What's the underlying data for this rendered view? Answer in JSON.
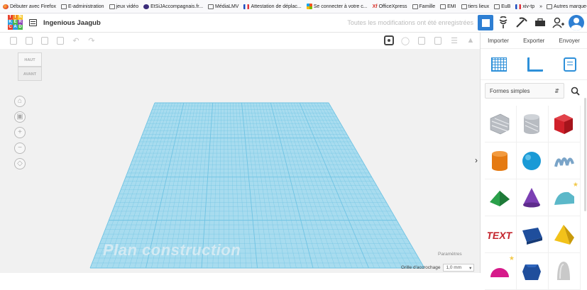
{
  "bookmarks": [
    {
      "icon": "firefox-icon",
      "label": "Débuter avec Firefox"
    },
    {
      "icon": "folder-icon",
      "label": "E-administration"
    },
    {
      "icon": "folder-icon",
      "label": "jeux vidéo"
    },
    {
      "icon": "globe-icon",
      "label": "EtSiJAccompagnais.fr..."
    },
    {
      "icon": "folder-icon",
      "label": "MédiaLMV"
    },
    {
      "icon": "flag-icon",
      "label": "Attestation de déplac..."
    },
    {
      "icon": "windows-icon",
      "label": "Se connecter à votre c..."
    },
    {
      "icon": "office-icon",
      "label": "OfficeXpress"
    },
    {
      "icon": "folder-icon",
      "label": "Famille"
    },
    {
      "icon": "folder-icon",
      "label": "EMI"
    },
    {
      "icon": "folder-icon",
      "label": "tiers lieux"
    },
    {
      "icon": "folder-icon",
      "label": "EuB"
    },
    {
      "icon": "flag-icon",
      "label": "xiv-tp"
    }
  ],
  "bookmarks_overflow": "»",
  "bookmarks_other": "Autres marque-pages",
  "header": {
    "logo_letters": [
      "TIN",
      "KER",
      "CAD"
    ],
    "project_title": "Ingenious Jaagub",
    "save_status": "Toutes les modifications ont été enregistrées"
  },
  "workplane": {
    "label": "Plan construction",
    "view_cube_top": "HAUT",
    "view_cube_front": "AVANT"
  },
  "footer": {
    "params_label": "Paramètres",
    "snap_label": "Grille d'accrochage",
    "snap_value": "1,0 mm"
  },
  "panel": {
    "tabs": [
      "Importer",
      "Exporter",
      "Envoyer"
    ],
    "category": "Formes simples",
    "shapes": [
      {
        "name": "box-hole-shape",
        "color": "#b8bcc2"
      },
      {
        "name": "cylinder-hole-shape",
        "color": "#b8bcc2"
      },
      {
        "name": "box-shape",
        "color": "#d0202a"
      },
      {
        "name": "cylinder-shape",
        "color": "#e57a12"
      },
      {
        "name": "sphere-shape",
        "color": "#1a9ad6"
      },
      {
        "name": "scribble-shape",
        "color": "#7aa4c8"
      },
      {
        "name": "roof-shape",
        "color": "#2aa04a"
      },
      {
        "name": "cone-shape",
        "color": "#7b3fb3"
      },
      {
        "name": "round-roof-shape",
        "color": "#5bb8c9"
      },
      {
        "name": "text-shape",
        "color": "#c4262e"
      },
      {
        "name": "prism-shape",
        "color": "#1f4e9c"
      },
      {
        "name": "pyramid-shape",
        "color": "#f2c21a"
      },
      {
        "name": "half-sphere-shape",
        "color": "#d61a8a"
      },
      {
        "name": "polygon-shape",
        "color": "#1f4e9c"
      },
      {
        "name": "paraboloid-shape",
        "color": "#c9c9c9"
      }
    ]
  },
  "colors": {
    "accent": "#2e7fd3",
    "plate": "#a8dcef",
    "grid_line": "#6fc3e3"
  }
}
